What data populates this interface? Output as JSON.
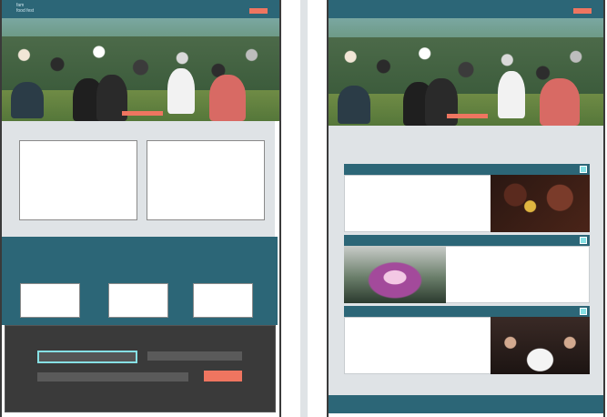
{
  "left": {
    "logo_line1": "fam",
    "logo_line2": "food fest"
  },
  "colors": {
    "teal": "#2c6677",
    "accent": "#ef7560",
    "light_gray": "#dfe3e6",
    "dark": "#3a3a3a",
    "cyan": "#86e0e4"
  },
  "cards": [
    {
      "image": "food-platter-photo"
    },
    {
      "image": "concert-stage-photo"
    },
    {
      "image": "restaurant-group-photo"
    }
  ]
}
